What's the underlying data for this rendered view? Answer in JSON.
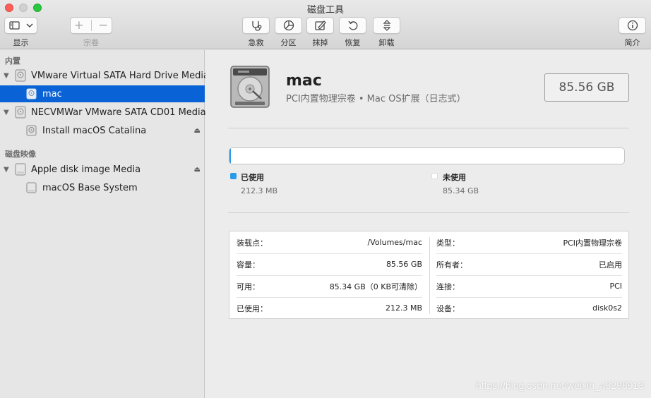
{
  "window": {
    "title": "磁盘工具"
  },
  "toolbar": {
    "view_label": "显示",
    "volume_label": "宗卷",
    "first_aid_label": "急救",
    "partition_label": "分区",
    "erase_label": "抹掉",
    "restore_label": "恢复",
    "unmount_label": "卸载",
    "info_label": "简介",
    "add_symbol": "+",
    "remove_symbol": "−"
  },
  "sidebar": {
    "sections": [
      {
        "title": "内置",
        "items": [
          {
            "label": "VMware Virtual SATA Hard Drive Media",
            "level": 0,
            "expanded": true,
            "selected": false
          },
          {
            "label": "mac",
            "level": 1,
            "selected": true
          }
        ]
      },
      {
        "items": [
          {
            "label": "NECVMWar VMware SATA CD01 Media",
            "level": 0,
            "expanded": true
          },
          {
            "label": "Install macOS Catalina",
            "level": 1,
            "ejectable": true
          }
        ]
      },
      {
        "title": "磁盘映像",
        "items": [
          {
            "label": "Apple disk image Media",
            "level": 0,
            "expanded": true,
            "ejectable": true
          },
          {
            "label": "macOS Base System",
            "level": 1
          }
        ]
      }
    ]
  },
  "main": {
    "volume_name": "mac",
    "volume_subtitle": "PCI内置物理宗卷 • Mac OS扩展（日志式）",
    "capacity": "85.56 GB",
    "usage": {
      "used_fraction": 0.0025,
      "used_color": "#2a9be8",
      "free_color": "#ffffff",
      "used_label": "已使用",
      "used_value": "212.3 MB",
      "free_label": "未使用",
      "free_value": "85.34 GB"
    },
    "info": {
      "left": [
        {
          "key": "装载点：",
          "value": "/Volumes/mac"
        },
        {
          "key": "容量：",
          "value": "85.56 GB"
        },
        {
          "key": "可用：",
          "value": "85.34 GB（0 KB可清除）"
        },
        {
          "key": "已使用：",
          "value": "212.3 MB"
        }
      ],
      "right": [
        {
          "key": "类型：",
          "value": "PCI内置物理宗卷"
        },
        {
          "key": "所有者：",
          "value": "已启用"
        },
        {
          "key": "连接：",
          "value": "PCI"
        },
        {
          "key": "设备：",
          "value": "disk0s2"
        }
      ]
    }
  },
  "watermark": "https://blog.csdn.net/weixin_43298913"
}
